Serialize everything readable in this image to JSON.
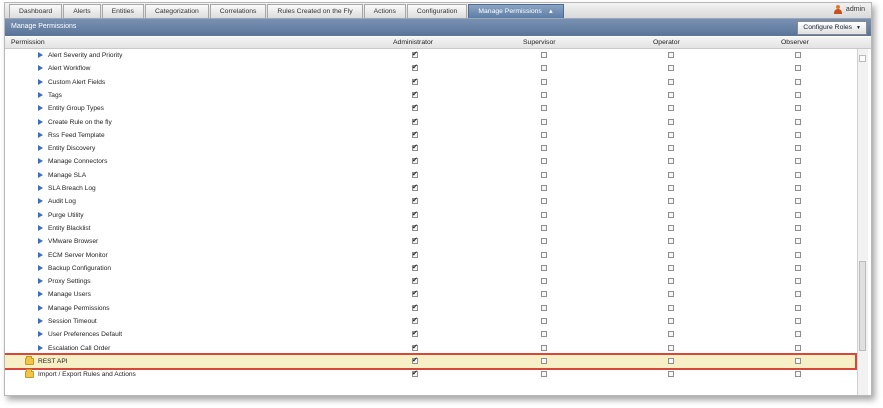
{
  "tabs": [
    {
      "label": "Dashboard",
      "active": false
    },
    {
      "label": "Alerts",
      "active": false
    },
    {
      "label": "Entities",
      "active": false
    },
    {
      "label": "Categorization",
      "active": false
    },
    {
      "label": "Correlations",
      "active": false
    },
    {
      "label": "Rules Created on the Fly",
      "active": false
    },
    {
      "label": "Actions",
      "active": false
    },
    {
      "label": "Configuration",
      "active": false
    },
    {
      "label": "Manage Permissions",
      "active": true
    }
  ],
  "user": {
    "name": "admin"
  },
  "panel": {
    "title": "Manage Permissions",
    "configure_roles": "Configure Roles"
  },
  "columns": {
    "permission": "Permission",
    "administrator": "Administrator",
    "supervisor": "Supervisor",
    "operator": "Operator",
    "observer": "Observer"
  },
  "rows": [
    {
      "label": "Alert Severity and Priority",
      "type": "item",
      "admin": true
    },
    {
      "label": "Alert Workflow",
      "type": "item",
      "admin": true
    },
    {
      "label": "Custom Alert Fields",
      "type": "item",
      "admin": true
    },
    {
      "label": "Tags",
      "type": "item",
      "admin": true
    },
    {
      "label": "Entity Group Types",
      "type": "item",
      "admin": true
    },
    {
      "label": "Create Rule on the fly",
      "type": "item",
      "admin": true
    },
    {
      "label": "Rss Feed Template",
      "type": "item",
      "admin": true
    },
    {
      "label": "Entity Discovery",
      "type": "item",
      "admin": true
    },
    {
      "label": "Manage Connectors",
      "type": "item",
      "admin": true
    },
    {
      "label": "Manage SLA",
      "type": "item",
      "admin": true
    },
    {
      "label": "SLA Breach Log",
      "type": "item",
      "admin": true
    },
    {
      "label": "Audit Log",
      "type": "item",
      "admin": true
    },
    {
      "label": "Purge Utility",
      "type": "item",
      "admin": true
    },
    {
      "label": "Entity Blacklist",
      "type": "item",
      "admin": true
    },
    {
      "label": "VMware Browser",
      "type": "item",
      "admin": true
    },
    {
      "label": "ECM Server Monitor",
      "type": "item",
      "admin": true
    },
    {
      "label": "Backup Configuration",
      "type": "item",
      "admin": true
    },
    {
      "label": "Proxy Settings",
      "type": "item",
      "admin": true
    },
    {
      "label": "Manage Users",
      "type": "item",
      "admin": true
    },
    {
      "label": "Manage Permissions",
      "type": "item",
      "admin": true
    },
    {
      "label": "Session Timeout",
      "type": "item",
      "admin": true
    },
    {
      "label": "User Preferences Default",
      "type": "item",
      "admin": true
    },
    {
      "label": "Escalation Call Order",
      "type": "item",
      "admin": true
    },
    {
      "label": "REST API",
      "type": "folder",
      "admin": true,
      "highlighted": true
    },
    {
      "label": "Import / Export Rules and Actions",
      "type": "folder",
      "admin": true
    }
  ]
}
